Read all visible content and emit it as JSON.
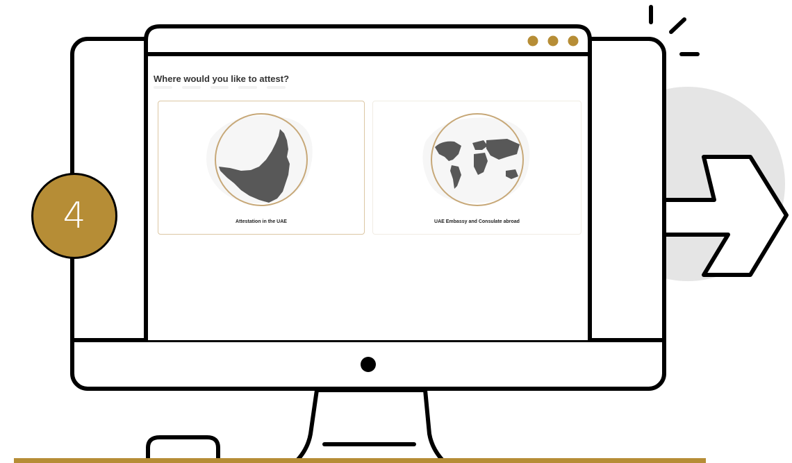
{
  "screen": {
    "question": "Where would you like to attest?",
    "window_dots": [
      "dot",
      "dot",
      "dot"
    ]
  },
  "options": [
    {
      "label": "Attestation in the UAE",
      "icon": "uae-map-icon",
      "selected": true
    },
    {
      "label": "UAE Embassy and Consulate abroad",
      "icon": "world-map-icon",
      "selected": false
    }
  ],
  "step": {
    "number": "4"
  },
  "colors": {
    "accent": "#b68d36",
    "outline": "#000000",
    "map": "#585858",
    "backdrop": "#e5e5e5"
  }
}
